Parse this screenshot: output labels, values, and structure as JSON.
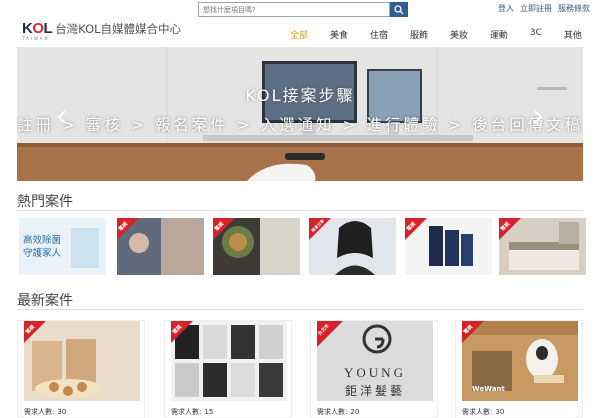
{
  "search": {
    "placeholder": "想找什麼項目嗎?"
  },
  "top_links": [
    "登入",
    "立即註冊",
    "服務條款"
  ],
  "brand": {
    "logo": "KOL",
    "logo_sub": "TAIWAN",
    "name": "台灣KOL自媒體媒合中心"
  },
  "nav": [
    "全部",
    "美食",
    "住宿",
    "服飾",
    "美妝",
    "運動",
    "3C",
    "其他"
  ],
  "hero": {
    "title": "KOL接案步驟",
    "steps": "註冊 > 審核 > 報名案件 > 入選通知 > 進行體驗 > 後台回傳文稿"
  },
  "sections": {
    "hot": "熱門案件",
    "new": "最新案件"
  },
  "hot_cards": [
    {
      "badge": "",
      "text": "高效除菌\n守護家人"
    },
    {
      "badge": "電視",
      "text": ""
    },
    {
      "badge": "電視",
      "text": ""
    },
    {
      "badge": "美食分享",
      "text": ""
    },
    {
      "badge": "電視",
      "text": ""
    },
    {
      "badge": "電視",
      "text": ""
    }
  ],
  "new_cards": [
    {
      "badge": "電視",
      "need_label": "需求人數:",
      "need_value": "30"
    },
    {
      "badge": "電視",
      "need_label": "需求人數:",
      "need_value": "15"
    },
    {
      "badge": "台北市",
      "need_label": "需求人數:",
      "need_value": "20",
      "brand_text": "YOUNG",
      "brand_sub": "鉅洋髮藝"
    },
    {
      "badge": "電視",
      "need_label": "需求人數:",
      "need_value": "30",
      "brand_text": "WeWant"
    }
  ],
  "colors": {
    "accent": "#c9a227",
    "badge": "#d6232a",
    "search_btn": "#2f5f93",
    "link": "#3b5b80"
  }
}
